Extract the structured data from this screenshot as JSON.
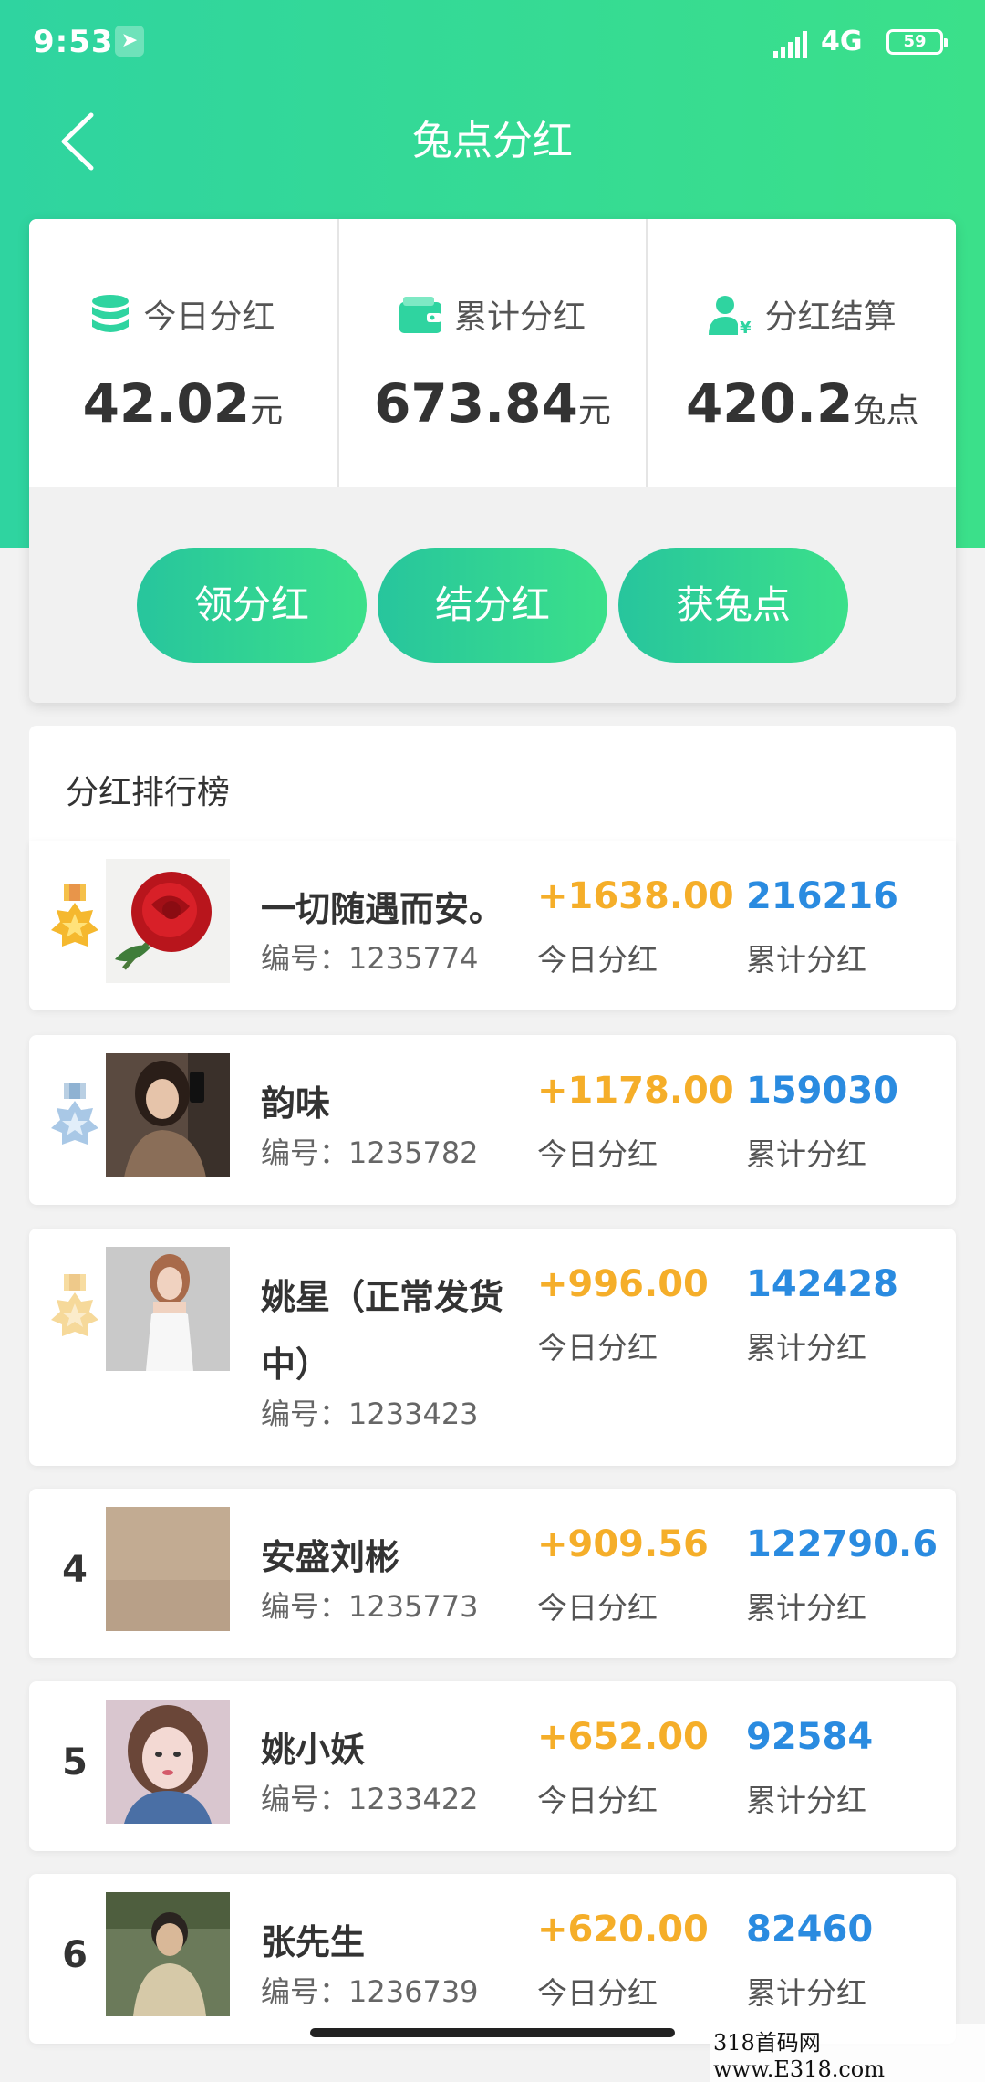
{
  "status": {
    "time": "9:53",
    "network": "4G",
    "battery": "59"
  },
  "nav": {
    "title": "兔点分红"
  },
  "summary": {
    "stats": [
      {
        "label": "今日分红",
        "value": "42.02",
        "unit": "元",
        "icon": "database-icon"
      },
      {
        "label": "累计分红",
        "value": "673.84",
        "unit": "元",
        "icon": "wallet-icon"
      },
      {
        "label": "分红结算",
        "value": "420.2",
        "unit": "兔点",
        "icon": "user-yen-icon"
      }
    ],
    "actions": [
      "领分红",
      "结分红",
      "获兔点"
    ]
  },
  "leaderboard": {
    "title": "分红排行榜",
    "today_label": "今日分红",
    "total_label": "累计分红",
    "id_prefix": "编号：",
    "rows": [
      {
        "rank": "1",
        "name": "一切随遇而安。",
        "id": "1235774",
        "today": "+1638.00",
        "total": "216216"
      },
      {
        "rank": "2",
        "name": "韵味",
        "id": "1235782",
        "today": "+1178.00",
        "total": "159030"
      },
      {
        "rank": "3",
        "name": "姚星（正常发货中）",
        "id": "1233423",
        "today": "+996.00",
        "total": "142428"
      },
      {
        "rank": "4",
        "name": "安盛刘彬",
        "id": "1235773",
        "today": "+909.56",
        "total": "122790.6"
      },
      {
        "rank": "5",
        "name": "姚小妖",
        "id": "1233422",
        "today": "+652.00",
        "total": "92584"
      },
      {
        "rank": "6",
        "name": "张先生",
        "id": "1236739",
        "today": "+620.00",
        "total": "82460"
      }
    ]
  },
  "watermark": "318首码网  www.E318.com",
  "colors": {
    "accent": "#2fd4a0",
    "gold": "#f5ae29",
    "blue": "#2a8be0"
  }
}
